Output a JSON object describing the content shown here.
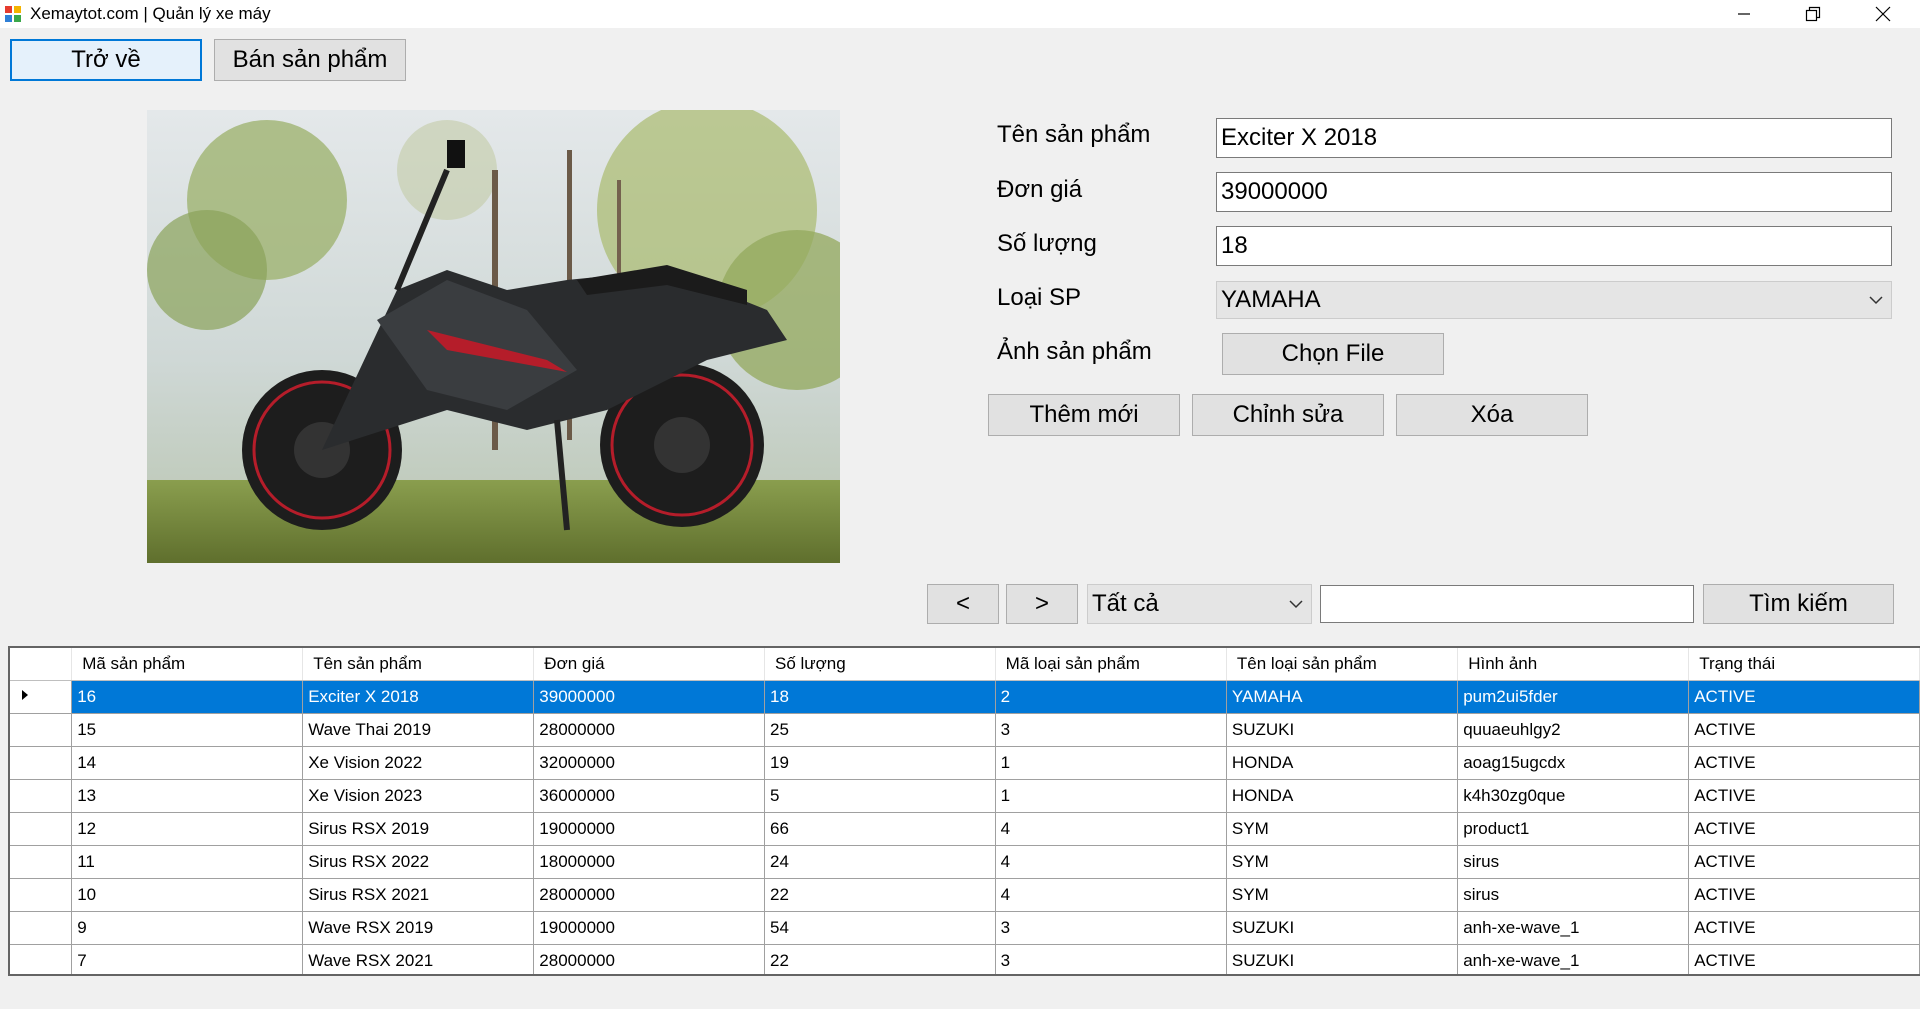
{
  "window": {
    "title": "Xemaytot.com | Quản lý xe máy"
  },
  "toolbar": {
    "back_label": "Trở về",
    "sell_label": "Bán sản phẩm"
  },
  "form": {
    "name_label": "Tên sản phẩm",
    "name_value": "Exciter X 2018",
    "price_label": "Đơn giá",
    "price_value": "39000000",
    "qty_label": "Số lượng",
    "qty_value": "18",
    "type_label": "Loại SP",
    "type_value": "YAMAHA",
    "image_label": "Ảnh sản phẩm",
    "choose_file_label": "Chọn File",
    "add_label": "Thêm mới",
    "edit_label": "Chỉnh sửa",
    "delete_label": "Xóa"
  },
  "search": {
    "prev_label": "<",
    "next_label": ">",
    "filter_value": "Tất cả",
    "query_value": "",
    "search_label": "Tìm kiếm"
  },
  "table": {
    "columns": [
      "Mã sản phẩm",
      "Tên sản phẩm",
      "Đơn giá",
      "Số lượng",
      "Mã loại sản phẩm",
      "Tên loại sản phẩm",
      "Hình ảnh",
      "Trạng thái"
    ],
    "rows": [
      [
        "16",
        "Exciter X 2018",
        "39000000",
        "18",
        "2",
        "YAMAHA",
        "pum2ui5fder",
        "ACTIVE"
      ],
      [
        "15",
        "Wave Thai 2019",
        "28000000",
        "25",
        "3",
        "SUZUKI",
        "quuaeuhlgy2",
        "ACTIVE"
      ],
      [
        "14",
        "Xe Vision 2022",
        "32000000",
        "19",
        "1",
        "HONDA",
        "aoag15ugcdx",
        "ACTIVE"
      ],
      [
        "13",
        "Xe Vision 2023",
        "36000000",
        "5",
        "1",
        "HONDA",
        "k4h30zg0que",
        "ACTIVE"
      ],
      [
        "12",
        "Sirus RSX 2019",
        "19000000",
        "66",
        "4",
        "SYM",
        "product1",
        "ACTIVE"
      ],
      [
        "11",
        "Sirus RSX 2022",
        "18000000",
        "24",
        "4",
        "SYM",
        "sirus",
        "ACTIVE"
      ],
      [
        "10",
        "Sirus RSX 2021",
        "28000000",
        "22",
        "4",
        "SYM",
        "sirus",
        "ACTIVE"
      ],
      [
        "9",
        "Wave RSX 2019",
        "19000000",
        "54",
        "3",
        "SUZUKI",
        "anh-xe-wave_1",
        "ACTIVE"
      ],
      [
        "7",
        "Wave RSX 2021",
        "28000000",
        "22",
        "3",
        "SUZUKI",
        "anh-xe-wave_1",
        "ACTIVE"
      ]
    ],
    "selected_row": 0
  },
  "colors": {
    "selection": "#0078d7",
    "button": "#e1e1e1",
    "background": "#f0f0f0"
  }
}
